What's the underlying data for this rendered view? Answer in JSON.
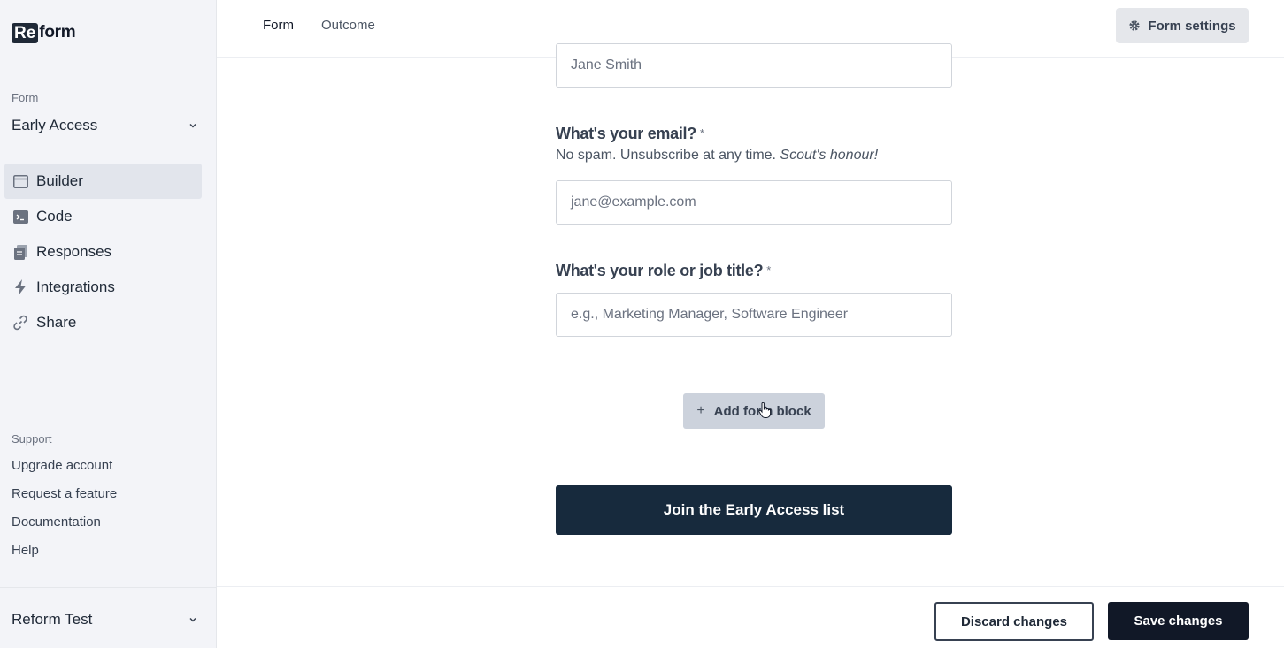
{
  "app": {
    "logo_box": "Re",
    "logo_rest": "form"
  },
  "sidebar": {
    "form_section_label": "Form",
    "selected_form": "Early Access",
    "nav": [
      {
        "label": "Builder",
        "icon": "browser-window-icon",
        "active": true
      },
      {
        "label": "Code",
        "icon": "terminal-icon",
        "active": false
      },
      {
        "label": "Responses",
        "icon": "clipboard-icon",
        "active": false
      },
      {
        "label": "Integrations",
        "icon": "lightning-icon",
        "active": false
      },
      {
        "label": "Share",
        "icon": "link-icon",
        "active": false
      }
    ],
    "support_label": "Support",
    "support_links": [
      "Upgrade account",
      "Request a feature",
      "Documentation",
      "Help"
    ],
    "workspace": "Reform Test"
  },
  "topbar": {
    "tabs": [
      {
        "label": "Form",
        "active": true
      },
      {
        "label": "Outcome",
        "active": false
      }
    ],
    "settings_label": "Form settings"
  },
  "form": {
    "name_placeholder": "Jane Smith",
    "email": {
      "label": "What's your email?",
      "required_mark": "*",
      "help_text": "No spam. Unsubscribe at any time.",
      "help_emphasis": "Scout's honour!",
      "placeholder": "jane@example.com"
    },
    "role": {
      "label": "What's your role or job title?",
      "required_mark": "*",
      "placeholder": "e.g., Marketing Manager, Software Engineer"
    },
    "add_block_label": "Add form block",
    "submit_label": "Join the Early Access list"
  },
  "footer": {
    "discard_label": "Discard changes",
    "save_label": "Save changes"
  },
  "colors": {
    "sidebar_bg": "#f3f4f8",
    "primary_dark": "#172a3d",
    "active_nav_bg": "#e2e5ec"
  }
}
